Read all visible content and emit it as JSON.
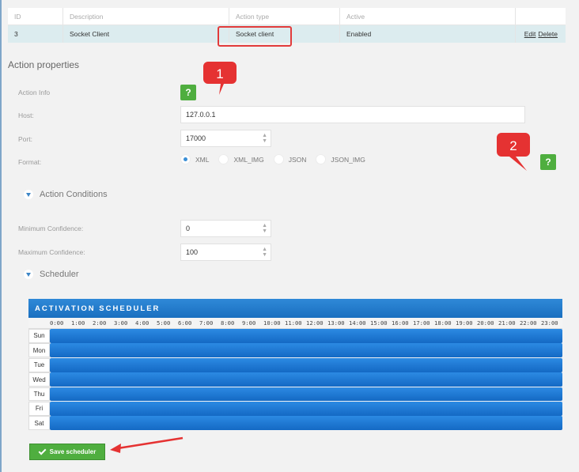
{
  "table": {
    "headers": [
      "ID",
      "Description",
      "Action type",
      "Active",
      ""
    ],
    "row": {
      "id": "3",
      "description": "Socket Client",
      "action_type": "Socket client",
      "active": "Enabled",
      "edit_label": "Edit",
      "delete_label": "Delete"
    }
  },
  "action_properties": {
    "title": "Action properties",
    "action_info_label": "Action Info",
    "help_label": "?",
    "host_label": "Host:",
    "host_value": "127.0.0.1",
    "port_label": "Port:",
    "port_value": "17000",
    "format_label": "Format:",
    "format_options": [
      "XML",
      "XML_IMG",
      "JSON",
      "JSON_IMG"
    ],
    "format_selected": "XML"
  },
  "conditions": {
    "title": "Action Conditions",
    "min_label": "Minimum Confidence:",
    "min_value": "0",
    "max_label": "Maximum Confidence:",
    "max_value": "100"
  },
  "scheduler": {
    "section_title": "Scheduler",
    "header": "ACTIVATION SCHEDULER",
    "hours": [
      "0:00",
      "1:00",
      "2:00",
      "3:00",
      "4:00",
      "5:00",
      "6:00",
      "7:00",
      "8:00",
      "9:00",
      "10:00",
      "11:00",
      "12:00",
      "13:00",
      "14:00",
      "15:00",
      "16:00",
      "17:00",
      "18:00",
      "19:00",
      "20:00",
      "21:00",
      "22:00",
      "23:00"
    ],
    "days": [
      "Sun",
      "Mon",
      "Tue",
      "Wed",
      "Thu",
      "Fri",
      "Sat"
    ],
    "save_label": "Save scheduler"
  },
  "annotations": {
    "callout_1": "1",
    "callout_2": "2"
  },
  "colors": {
    "accent_blue": "#1a6fc0",
    "help_green": "#4fae3f",
    "highlight_red": "#e23b3b"
  }
}
